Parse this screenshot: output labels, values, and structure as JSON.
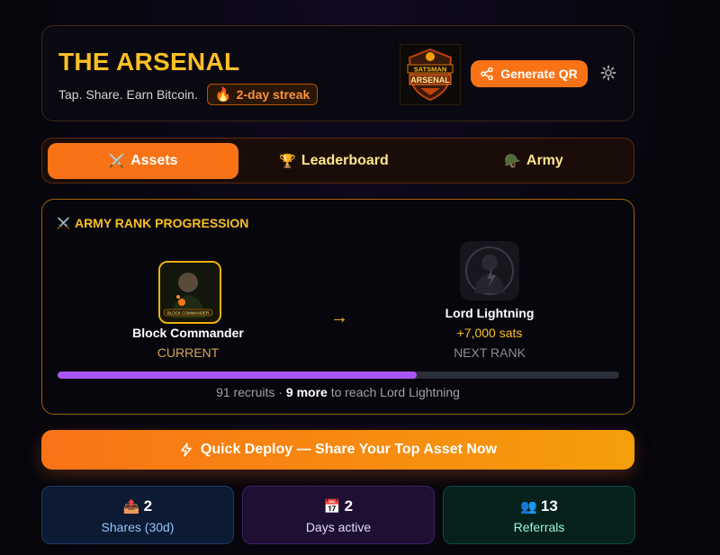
{
  "header": {
    "title": "THE ARSENAL",
    "tagline": "Tap. Share. Earn Bitcoin.",
    "streak": "2-day streak",
    "logo_text_top": "SATSMAN",
    "logo_text_bottom": "ARSENAL",
    "generate_qr_label": "Generate QR"
  },
  "tabs": [
    {
      "label": "Assets",
      "icon": "crossed-swords-icon",
      "active": true
    },
    {
      "label": "Leaderboard",
      "icon": "trophy-icon",
      "active": false
    },
    {
      "label": "Army",
      "icon": "helmet-icon",
      "active": false
    }
  ],
  "rank": {
    "title": "ARMY RANK PROGRESSION",
    "current": {
      "name": "Block Commander",
      "status": "CURRENT",
      "badge_text": "BLOCK COMMANDER"
    },
    "next": {
      "name": "Lord Lightning",
      "reward": "+7,000 sats",
      "status": "NEXT RANK"
    },
    "progress_percent": 64,
    "recruits_text": "91 recruits ·",
    "more_text": "9 more",
    "reach_text": "to reach Lord Lightning"
  },
  "deploy": {
    "label": "Quick Deploy — Share Your Top Asset Now"
  },
  "stats": [
    {
      "value": "2",
      "label": "Shares (30d)",
      "icon": "outbox-tray-icon"
    },
    {
      "value": "2",
      "label": "Days active",
      "icon": "calendar-icon"
    },
    {
      "value": "13",
      "label": "Referrals",
      "icon": "people-icon"
    }
  ],
  "colors": {
    "accent": "#f97316",
    "gold": "#fbbf24",
    "progress": "#a855f7"
  }
}
